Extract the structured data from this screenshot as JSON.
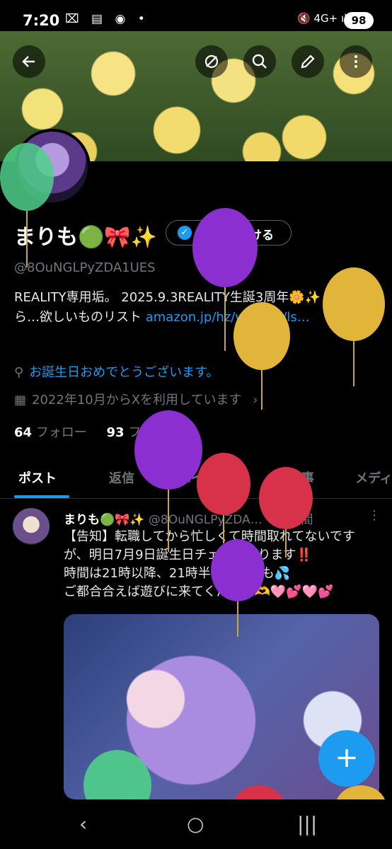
{
  "status": {
    "time": "7:20",
    "left_icons": "⌧ ▤ ◉ •",
    "right_icons": "🔇 4G+ ıl",
    "battery": "98"
  },
  "header": {
    "back_icon": "arrow-left-icon",
    "actions": [
      "hide-icon",
      "search-icon",
      "edit-icon",
      "more-icon"
    ]
  },
  "profile": {
    "name": "まりも🟢🎀✨",
    "verify_label": "認証を受ける",
    "handle": "@8OuNGLPyZDA1UES",
    "bio_text": "REALITY専用垢。 2025.9.3REALITY生誕3周年🌼✨ 恐れながら…欲しいものリスト ",
    "bio_link": "amazon.jp/hz/wishlist/ls…",
    "location": "お誕生日おめでとうございます。",
    "joined": "2022年10月からXを利用しています",
    "joined_chevron": "›",
    "following_count": "64",
    "following_label": "フォロー",
    "followers_count": "93",
    "followers_label": "フォロワー"
  },
  "tabs": [
    "ポスト",
    "返信",
    "ハイライト",
    "記事",
    "メディア"
  ],
  "tweet": {
    "name": "まりも🟢🎀✨",
    "handle": "@8OuNGLPyZDA…",
    "time": "· 22時間",
    "more": "⋮",
    "body": "【告知】転職してから忙しくて時間取れてないですが、明日7月9日誕生日チェキ会やります‼️\n時間は21時以降、21時半くらいかも💦\nご都合合えば遊びに来てください🫶🩷💕🩷💕"
  },
  "fab": "+",
  "navbar": {
    "recent": "|||",
    "home": "○",
    "back": "‹"
  },
  "colors": {
    "accent": "#1d9bf0",
    "green_balloon": "#4fd08a",
    "purple_balloon": "#8b2fd0",
    "gold_balloon": "#e0b53a",
    "red_balloon": "#d8324a"
  }
}
